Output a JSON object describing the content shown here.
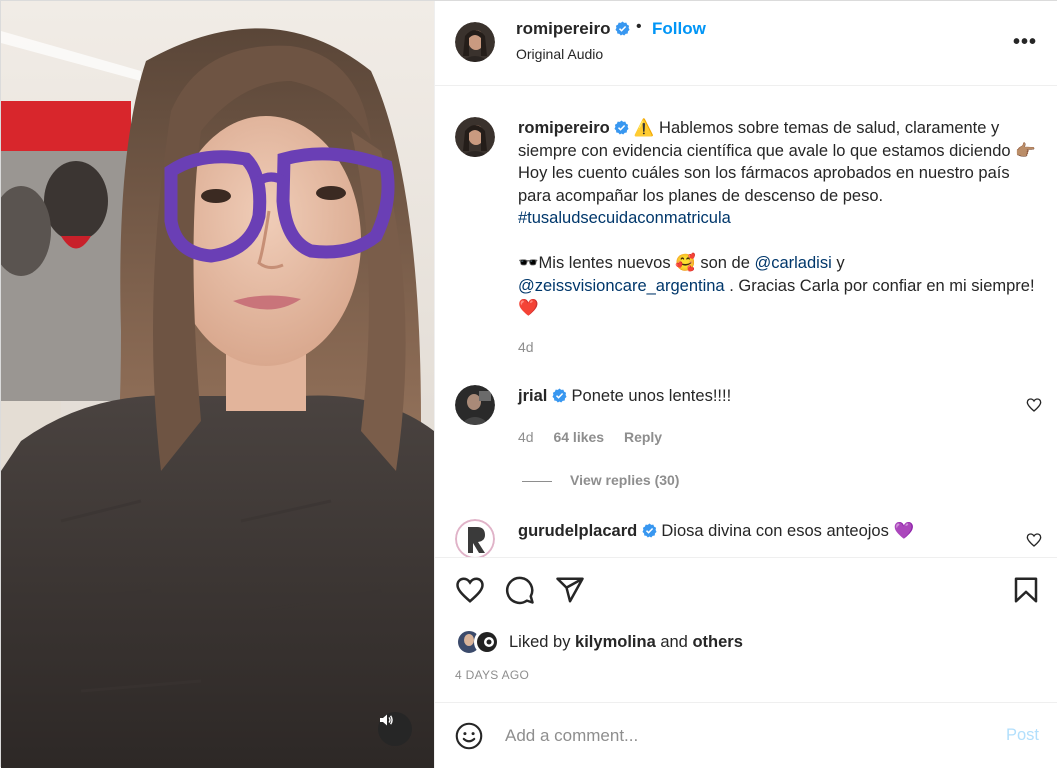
{
  "header": {
    "username": "romipereiro",
    "separator": "•",
    "follow_label": "Follow",
    "audio": "Original Audio",
    "more_label": "•••"
  },
  "caption": {
    "username": "romipereiro",
    "emoji_warning": "⚠️",
    "line1": " Hablemos sobre temas de salud, claramente y siempre con evidencia científica que avale lo que estamos diciendo ",
    "emoji_point": "👉🏽",
    "line2": "Hoy les cuento cuáles son los fármacos aprobados en nuestro país para acompañar los planes de descenso de peso.",
    "hashtag": "#tusaludsecuidaconmatricula",
    "emoji_sunglasses": "🕶️",
    "line3": "Mis lentes nuevos ",
    "emoji_love": "🥰",
    "line3b": " son de ",
    "mention1": "@carladisi",
    "line3c": " y",
    "mention2": "@zeissvisioncare_argentina",
    "line4": " . Gracias Carla por confiar en mi siempre! ",
    "emoji_heart": "❤️",
    "time": "4d"
  },
  "comments": [
    {
      "username": "jrial",
      "text": "Ponete unos lentes!!!!",
      "time": "4d",
      "likes": "64 likes",
      "reply": "Reply",
      "view_replies": "View replies (30)"
    },
    {
      "username": "gurudelplacard",
      "text": "Diosa divina con esos anteojos ",
      "emoji": "💜"
    }
  ],
  "likes": {
    "prefix": "Liked by ",
    "user": "kilymolina",
    "middle": " and ",
    "others": "others",
    "date": "4 DAYS AGO"
  },
  "comment_box": {
    "placeholder": "Add a comment...",
    "post_label": "Post"
  },
  "icons": {
    "like": "heart-icon",
    "comment": "comment-icon",
    "share": "share-icon",
    "save": "bookmark-icon",
    "emoji": "emoji-icon",
    "sound": "speaker-icon",
    "verified": "verified-badge-icon"
  },
  "colors": {
    "accent": "#0095f6",
    "link": "#00376b",
    "secondary": "#8e8e8e",
    "post_disabled": "#b2dffc",
    "verified": "#3897f0"
  }
}
